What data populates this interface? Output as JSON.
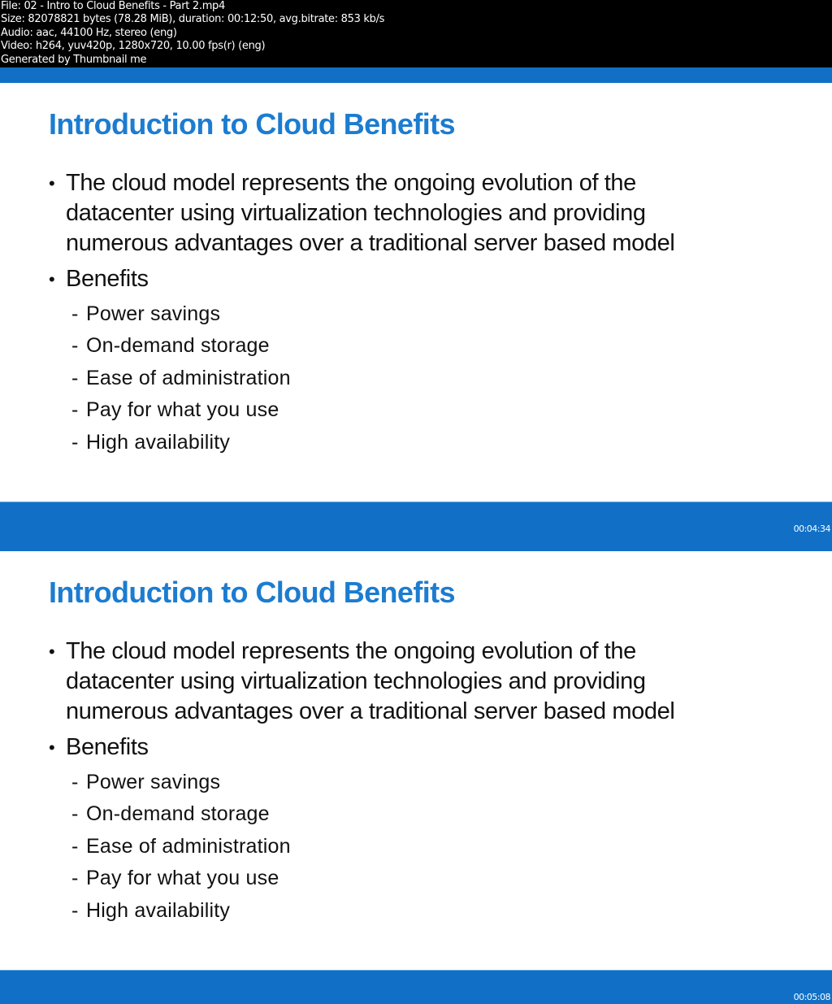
{
  "file_info": {
    "lines": [
      "File: 02 - Intro to Cloud Benefits - Part 2.mp4",
      "Size: 82078821 bytes (78.28 MiB), duration: 00:12:50, avg.bitrate: 853 kb/s",
      "Audio: aac, 44100 Hz, stereo (eng)",
      "Video: h264, yuv420p, 1280x720, 10.00 fps(r) (eng)",
      "Generated by Thumbnail me"
    ]
  },
  "colors": {
    "band_blue": "#1170c6",
    "title_blue": "#1c7cd0"
  },
  "frames": [
    {
      "timestamp": "00:04:34",
      "title": "Introduction to Cloud Benefits",
      "bullets": [
        {
          "lines": [
            "The cloud model represents the ongoing evolution of the",
            "datacenter using virtualization technologies and providing",
            "numerous advantages over a traditional server based model"
          ]
        },
        {
          "lines": [
            "Benefits"
          ]
        }
      ],
      "sub_bullets": [
        "Power savings",
        "On-demand storage",
        "Ease of administration",
        "Pay for what you use",
        "High availability"
      ]
    },
    {
      "timestamp": "00:05:08",
      "title": "Introduction to Cloud Benefits",
      "bullets": [
        {
          "lines": [
            "The cloud model represents the ongoing evolution of the",
            "datacenter using virtualization technologies and providing",
            "numerous advantages over a traditional server based model"
          ]
        },
        {
          "lines": [
            "Benefits"
          ]
        }
      ],
      "sub_bullets": [
        "Power savings",
        "On-demand storage",
        "Ease of administration",
        "Pay for what you use",
        "High availability"
      ]
    }
  ],
  "glyphs": {
    "bullet": "•",
    "dash": "-"
  }
}
